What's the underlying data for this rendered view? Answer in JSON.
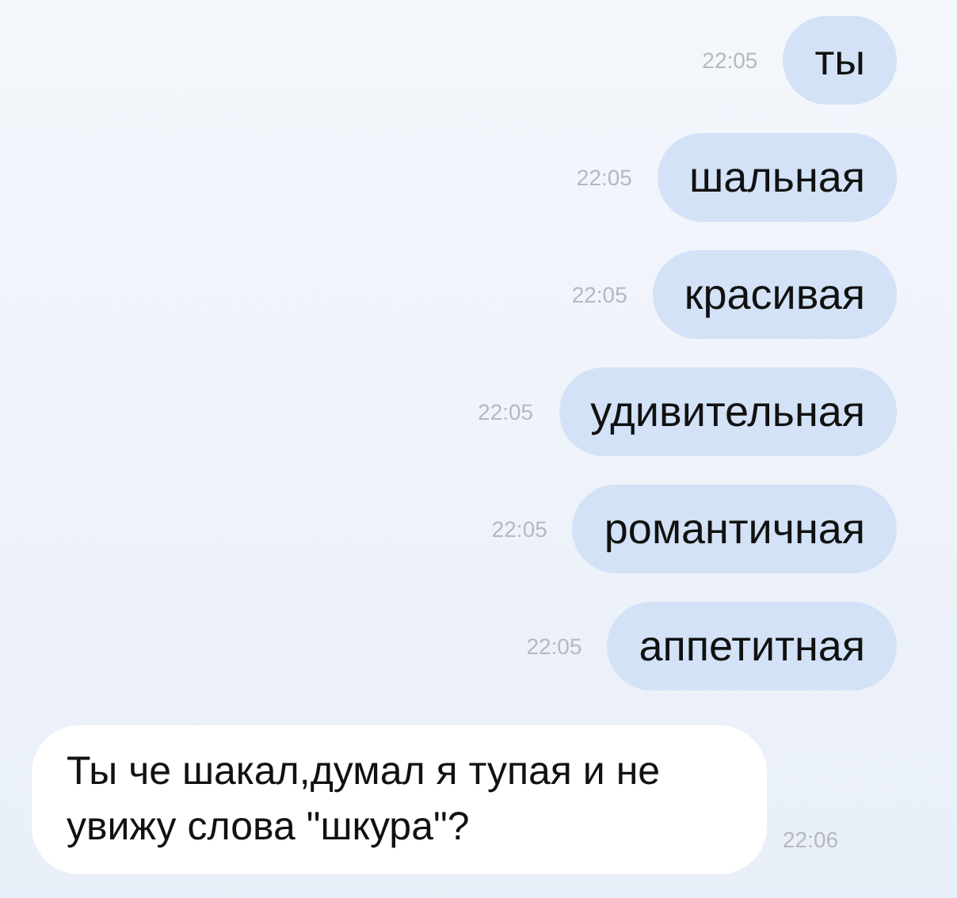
{
  "messages": [
    {
      "kind": "outgoing",
      "text": "ты",
      "time": "22:05"
    },
    {
      "kind": "outgoing",
      "text": "шальная",
      "time": "22:05"
    },
    {
      "kind": "outgoing",
      "text": "красивая",
      "time": "22:05"
    },
    {
      "kind": "outgoing",
      "text": "удивительная",
      "time": "22:05"
    },
    {
      "kind": "outgoing",
      "text": "романтичная",
      "time": "22:05"
    },
    {
      "kind": "outgoing",
      "text": "аппетитная",
      "time": "22:05"
    },
    {
      "kind": "incoming",
      "text": "Ты че шакал,думал я тупая и не увижу слова \"шкура\"?",
      "time": "22:06"
    }
  ]
}
